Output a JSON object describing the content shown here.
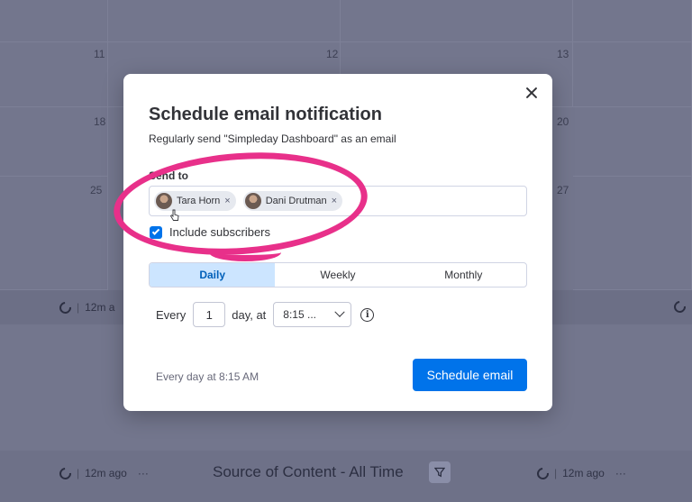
{
  "background": {
    "day_numbers": [
      "11",
      "12",
      "13",
      "18",
      "20",
      "25",
      "27"
    ],
    "strip_age": "12m a",
    "footer": {
      "left_age": "12m ago",
      "more": "···",
      "title": "Source of Content - All Time",
      "right_age": "12m ago",
      "right_more": "···"
    }
  },
  "modal": {
    "title": "Schedule email notification",
    "subtitle": "Regularly send \"Simpleday Dashboard\" as an email",
    "send_to_label": "Send to",
    "recipients": [
      {
        "name": "Tara Horn",
        "remove": "×"
      },
      {
        "name": "Dani Drutman",
        "remove": "×"
      }
    ],
    "include_subscribers": {
      "label": "Include subscribers",
      "checked": true
    },
    "frequency_tabs": [
      "Daily",
      "Weekly",
      "Monthly"
    ],
    "active_tab": "Daily",
    "every_label": "Every",
    "every_value": "1",
    "day_at_label": "day, at",
    "time_value": "8:15 ...",
    "info_glyph": "i",
    "summary": "Every day at 8:15 AM",
    "schedule_button": "Schedule email"
  },
  "colors": {
    "accent": "#0073ea",
    "highlight": "#e8308a",
    "tab_active_bg": "#cce5ff"
  },
  "icons": [
    "close-icon",
    "avatar-icon",
    "remove-icon",
    "check-icon",
    "chevron-down-icon",
    "info-icon",
    "refresh-icon",
    "filter-icon",
    "pointer-cursor-icon"
  ]
}
